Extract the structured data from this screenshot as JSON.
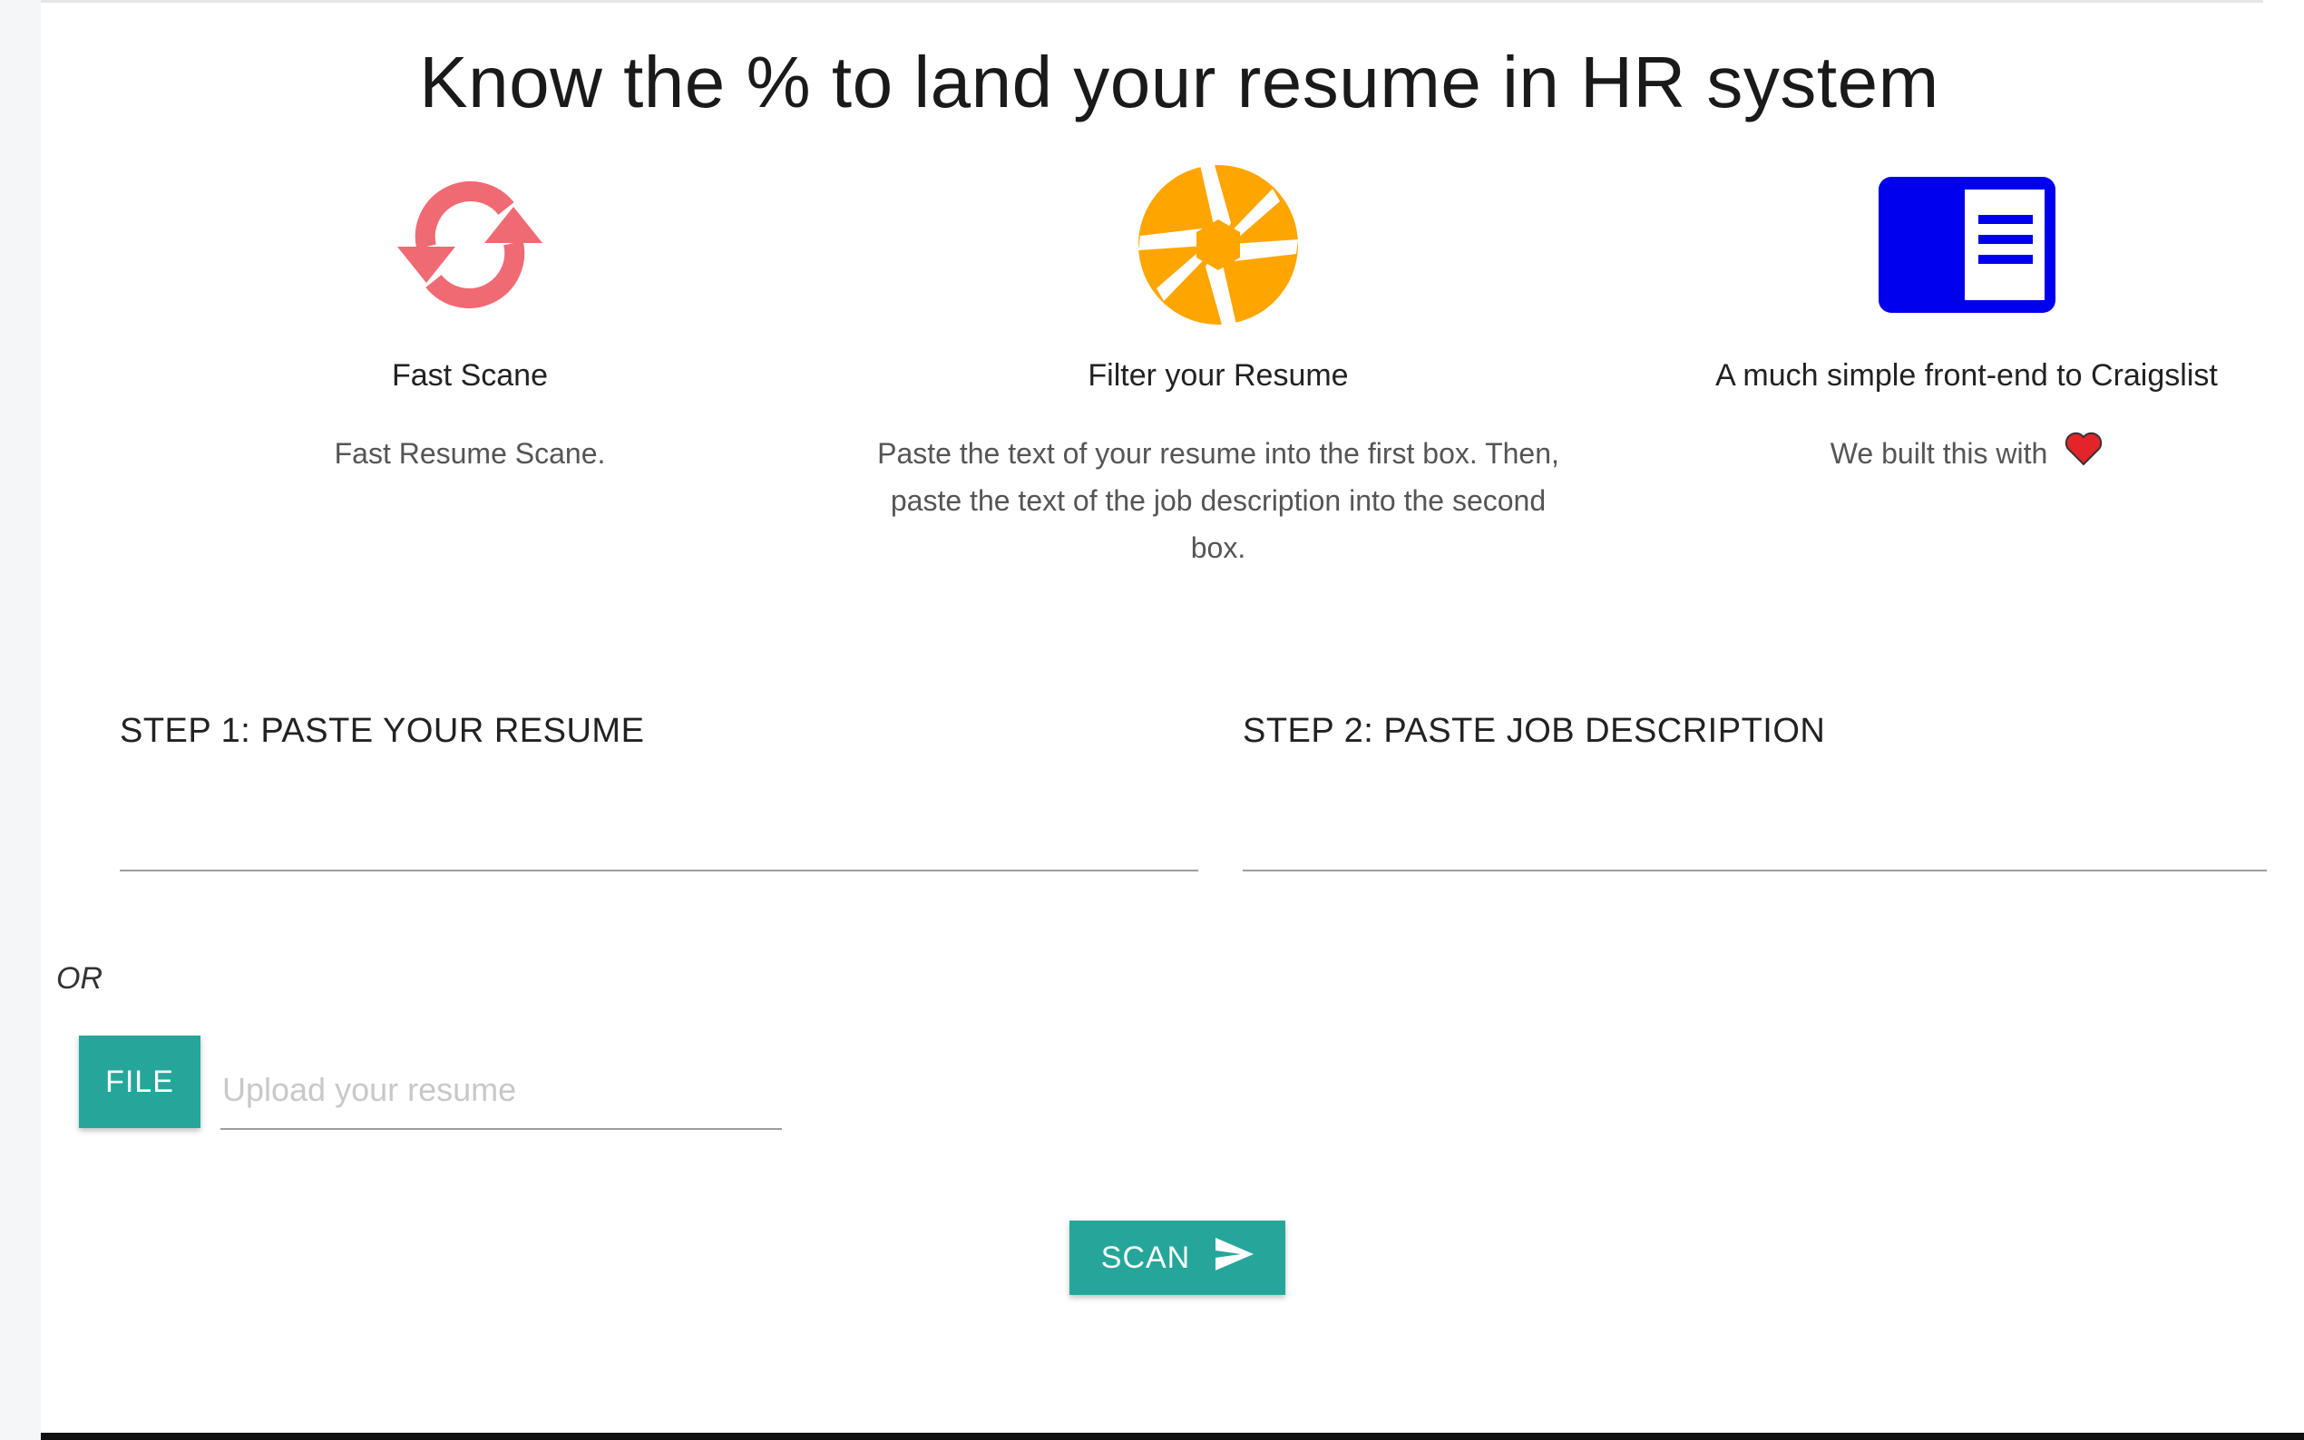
{
  "header": {
    "title": "Know the % to land your resume in HR system"
  },
  "features": [
    {
      "icon": "sync-icon",
      "title": "Fast Scane",
      "description": "Fast Resume Scane."
    },
    {
      "icon": "aperture-icon",
      "title": "Filter your Resume",
      "description": "Paste the text of your resume into the first box. Then, paste the text of the job description into the second box."
    },
    {
      "icon": "chrome-reader-mode-icon",
      "title": "A much simple front-end to Craigslist",
      "description": "We built this with"
    }
  ],
  "steps": {
    "step1_label": "STEP 1: PASTE YOUR RESUME",
    "step1_value": "",
    "step2_label": "STEP 2: PASTE JOB DESCRIPTION",
    "step2_value": ""
  },
  "upload": {
    "or_label": "OR",
    "file_button": "FILE",
    "placeholder": "Upload your resume"
  },
  "actions": {
    "scan_label": "SCAN"
  },
  "colors": {
    "accent": "#26a69a",
    "sync_icon": "#f06a73",
    "aperture_icon": "#ffa500",
    "reader_icon": "#0000ee",
    "heart": "#e3242b"
  }
}
